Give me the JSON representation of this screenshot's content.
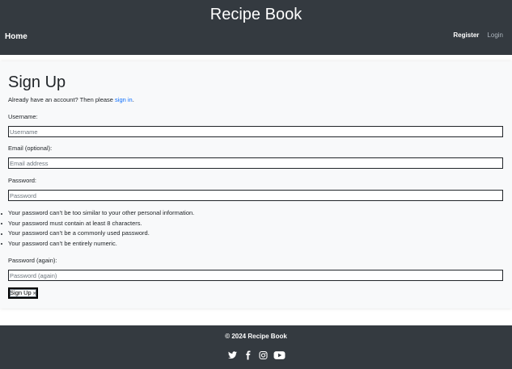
{
  "header": {
    "brand": "Recipe Book",
    "nav_home": "Home",
    "nav_register": "Register",
    "nav_login": "Login"
  },
  "form": {
    "title": "Sign Up",
    "intro_text": "Already have an account? Then please ",
    "intro_link": "sign in",
    "intro_end": ".",
    "username_label": "Username:",
    "username_placeholder": "Username",
    "email_label": "Email (optional):",
    "email_placeholder": "Email address",
    "password_label": "Password:",
    "password_placeholder": "Password",
    "password_help": [
      "Your password can’t be too similar to your other personal information.",
      "Your password must contain at least 8 characters.",
      "Your password can’t be a commonly used password.",
      "Your password can’t be entirely numeric."
    ],
    "password2_label": "Password (again):",
    "password2_placeholder": "Password (again)",
    "submit_label": "Sign Up »"
  },
  "footer": {
    "copyright": "© 2024 Recipe Book",
    "social_icons": [
      "twitter-icon",
      "facebook-icon",
      "instagram-icon",
      "youtube-icon"
    ]
  },
  "colors": {
    "navbar_bg": "#343a40",
    "card_bg": "#f8f9fa",
    "link": "#0d6efd",
    "muted_nav": "#adb5bd"
  }
}
